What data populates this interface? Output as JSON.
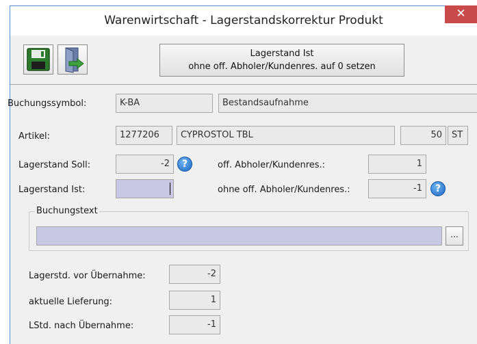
{
  "window": {
    "title": "Warenwirtschaft - Lagerstandskorrektur Produkt",
    "close_glyph": "✕"
  },
  "toolbar": {
    "save_icon": "floppy-disk-icon",
    "exit_icon": "exit-door-icon",
    "reset_line1": "Lagerstand Ist",
    "reset_line2": "ohne off. Abholer/Kundenres. auf 0 setzen"
  },
  "booking": {
    "label": "Buchungssymbol:",
    "code": "K-BA",
    "description": "Bestandsaufnahme"
  },
  "article": {
    "label": "Artikel:",
    "number": "1277206",
    "name": "CYPROSTOL TBL",
    "quantity": "50",
    "unit": "ST"
  },
  "stock": {
    "soll_label": "Lagerstand Soll:",
    "soll_value": "-2",
    "ist_label": "Lagerstand Ist:",
    "ist_value": "",
    "reservations_label": "off. Abholer/Kundenres.:",
    "reservations_value": "1",
    "without_label": "ohne off. Abholer/Kundenres.:",
    "without_value": "-1",
    "help_glyph": "?"
  },
  "bookingtext": {
    "legend": "Buchungstext",
    "value": "",
    "browse_label": "..."
  },
  "summary": {
    "before_label": "Lagerstd. vor Übernahme:",
    "before_value": "-2",
    "delivery_label": "aktuelle Lieferung:",
    "delivery_value": "1",
    "after_label": "LStd. nach Übernahme:",
    "after_value": "-1"
  },
  "colors": {
    "titlebar": "#ffffff",
    "close_button": "#c94a4a",
    "input_highlight": "#c8c8e4",
    "readonly_field": "#eaeaea",
    "dialog_background": "#f0f0f0"
  }
}
